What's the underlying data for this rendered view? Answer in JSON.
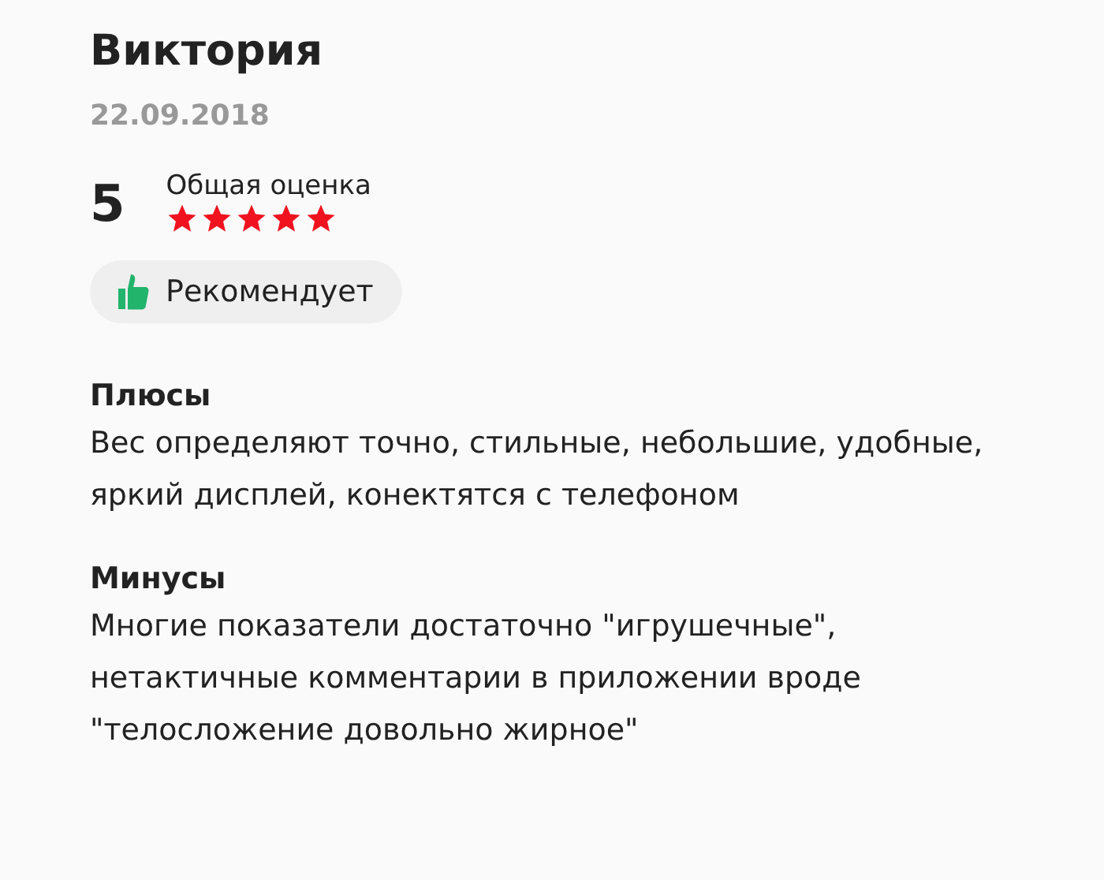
{
  "author": "Виктория",
  "date": "22.09.2018",
  "rating": {
    "score": "5",
    "label": "Общая оценка",
    "stars": 5
  },
  "recommendation": {
    "label": "Рекомендует"
  },
  "sections": [
    {
      "title": "Плюсы",
      "text": "Вес определяют точно, стильные, небольшие, удобные, яркий дисплей, конектятся с телефоном"
    },
    {
      "title": "Минусы",
      "text": "Многие показатели достаточно \"игрушечные\", нетактичные комментарии в приложении вроде \"телосложение довольно жирное\""
    }
  ]
}
